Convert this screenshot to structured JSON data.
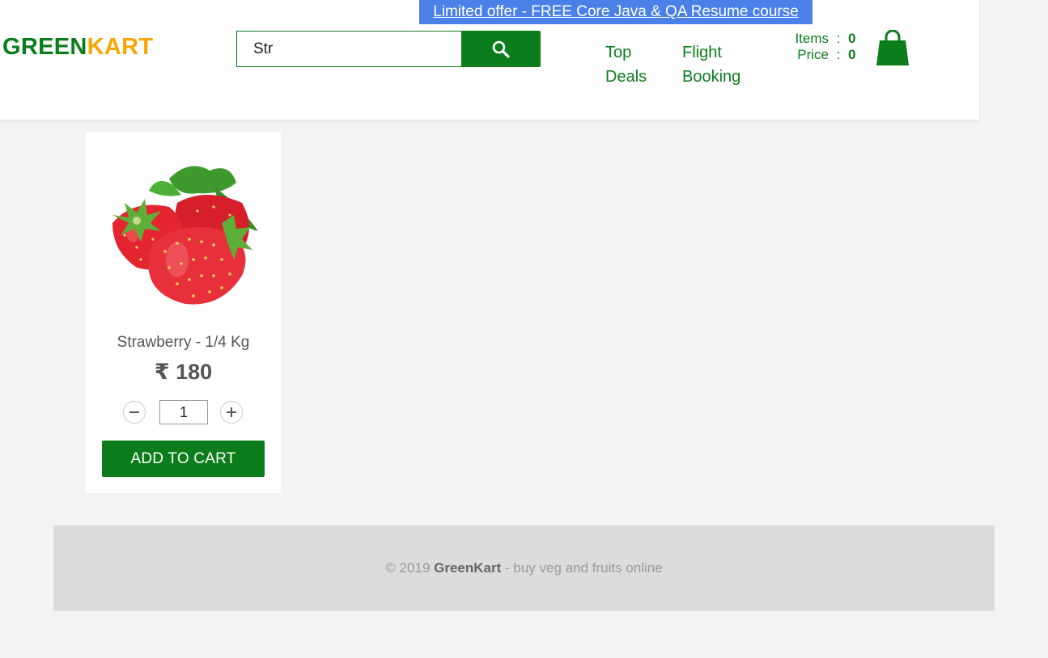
{
  "promo": {
    "text": "Limited offer - FREE Core Java & QA Resume course"
  },
  "brand": {
    "part1": "GREEN",
    "part2": "KART"
  },
  "search": {
    "value": "Str"
  },
  "nav": {
    "top_deals": "Top Deals",
    "flight_booking": "Flight Booking"
  },
  "cart": {
    "items_label": "Items",
    "items_value": "0",
    "price_label": "Price",
    "price_value": "0",
    "separator": ":"
  },
  "product": {
    "name": "Strawberry - 1/4 Kg",
    "price": "₹ 180",
    "quantity": "1",
    "add_label": "ADD TO CART",
    "image_icon": "strawberry-image"
  },
  "footer": {
    "prefix": "© 2019 ",
    "brand": "GreenKart",
    "suffix": " - buy veg and fruits online"
  },
  "colors": {
    "brand_green": "#0b7d1a",
    "brand_orange": "#f6a704",
    "promo_blue": "#4a80e8",
    "background": "#f3f3f3"
  }
}
